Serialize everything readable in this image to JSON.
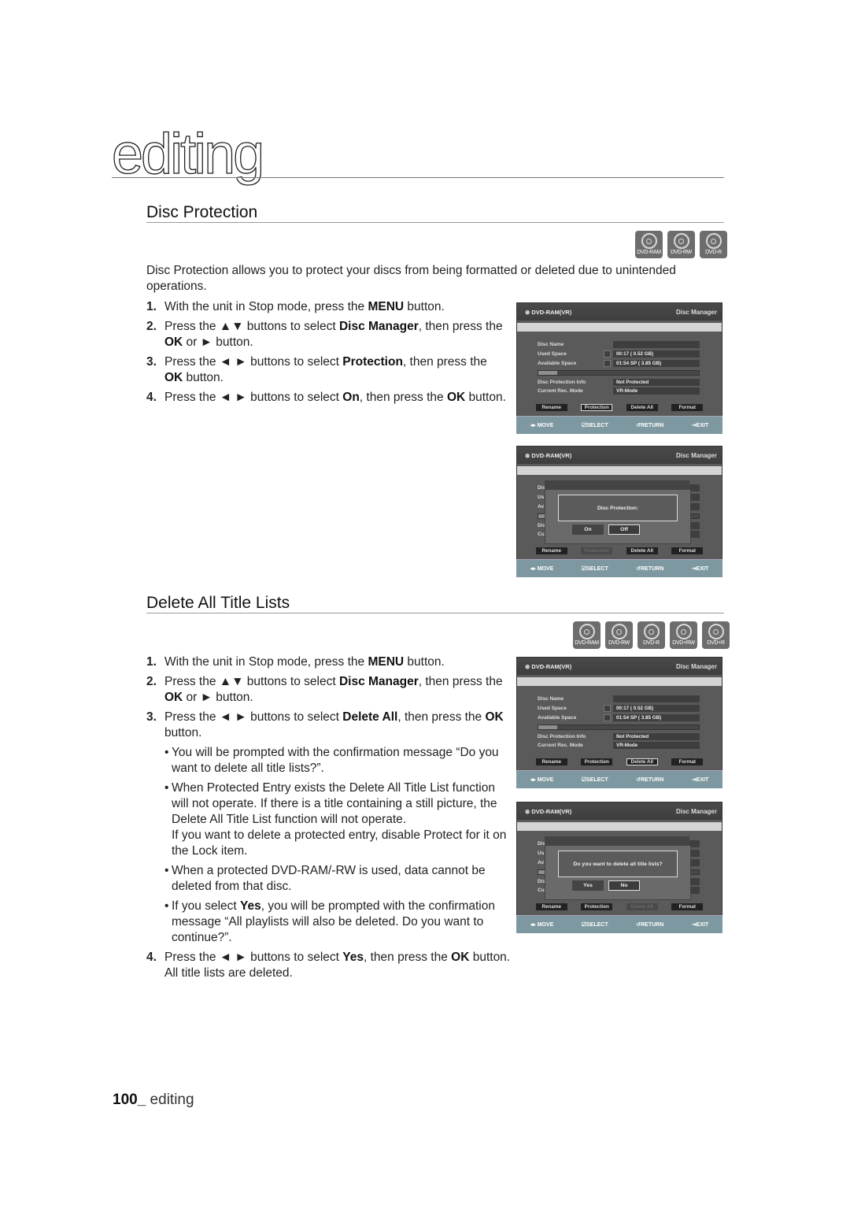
{
  "chapter": {
    "title": "editing"
  },
  "footer": {
    "page_number": "100_",
    "chapter": " editing"
  },
  "sections": [
    {
      "title": "Disc Protection",
      "badges": [
        "DVD-RAM",
        "DVD-RW",
        "DVD-R"
      ],
      "intro": "Disc Protection allows you to protect your discs from being formatted or deleted due to unintended operations.",
      "steps": [
        {
          "num": "1.",
          "parts": [
            "With the unit in Stop mode, press the ",
            "MENU",
            " button."
          ]
        },
        {
          "num": "2.",
          "parts": [
            "Press the ▲▼ buttons to select ",
            "Disc Manager",
            ", then press the ",
            "OK",
            " or ► button."
          ]
        },
        {
          "num": "3.",
          "parts": [
            "Press the ◄ ► buttons to select ",
            "Protection",
            ", then press the ",
            "OK",
            " button."
          ]
        },
        {
          "num": "4.",
          "parts": [
            "Press the ◄ ► buttons to select ",
            "On",
            ", then press the ",
            "OK",
            " button."
          ]
        }
      ]
    },
    {
      "title": "Delete All Title Lists",
      "badges": [
        "DVD-RAM",
        "DVD-RW",
        "DVD-R",
        "DVD+RW",
        "DVD+R"
      ],
      "steps": [
        {
          "num": "1.",
          "parts": [
            "With the unit in Stop mode, press the ",
            "MENU",
            " button."
          ]
        },
        {
          "num": "2.",
          "parts": [
            "Press the ▲▼ buttons to select ",
            "Disc Manager",
            ", then press the ",
            "OK",
            " or ► button."
          ]
        },
        {
          "num": "3.",
          "parts": [
            "Press the ◄ ► buttons to select ",
            "Delete All",
            ", then press the ",
            "OK",
            " button."
          ]
        },
        {
          "num": "4.",
          "parts": [
            "Press the ◄ ► buttons to select ",
            "Yes",
            ", then press the ",
            "OK",
            " button. All title lists are deleted."
          ]
        }
      ],
      "bullets": [
        {
          "parts": [
            "You will be prompted with the confirmation message “Do you want to delete all title lists?”."
          ]
        },
        {
          "parts": [
            "When Protected Entry exists the Delete All Title List function will not operate. If there is a title containing a still picture, the Delete All Title List function will not operate.\nIf you want to delete a protected entry, disable Protect for it on the Lock item."
          ]
        },
        {
          "parts": [
            "When a protected DVD-RAM/-RW is used, data cannot be deleted from that disc."
          ]
        },
        {
          "parts": [
            "If you select ",
            "Yes",
            ", you will be prompted with the confirmation message “All playlists will also be deleted. Do you want to continue?”."
          ]
        }
      ]
    }
  ],
  "osd": {
    "disc_type": "DVD-RAM(VR)",
    "menu_title": "Disc Manager",
    "labels": {
      "disc_name": "Disc Name",
      "used_space": "Used Space",
      "available_space": "Available Space",
      "protection_info": "Disc Protection Info",
      "rec_mode": "Current Rec. Mode"
    },
    "values": {
      "disc_name": "",
      "used_space": "00:17      (  0.52 GB)",
      "available_space": "01:54 SP   (  3.85 GB)",
      "protection_info": "Not Protected",
      "rec_mode": "VR-Mode"
    },
    "space_used_fraction": 0.12,
    "truncated_labels": [
      "Dis",
      "Us",
      "Av",
      "Dis",
      "Cu"
    ],
    "buttons": [
      "Rename",
      "Protection",
      "Delete All",
      "Format"
    ],
    "footer": [
      "◂▸ MOVE",
      "SELECT",
      "RETURN",
      "EXIT"
    ],
    "screens": [
      {
        "selected_button": "Protection"
      },
      {
        "popup_message": "Disc Protection:",
        "popup_buttons": [
          "On",
          "Off"
        ],
        "popup_selected": "Off",
        "dimmed_button": "Protection"
      },
      {
        "selected_button": "Delete All"
      },
      {
        "popup_message": "Do you want to delete all title lists?",
        "popup_buttons": [
          "Yes",
          "No"
        ],
        "popup_selected": "No",
        "dimmed_button": "Delete All"
      }
    ]
  }
}
